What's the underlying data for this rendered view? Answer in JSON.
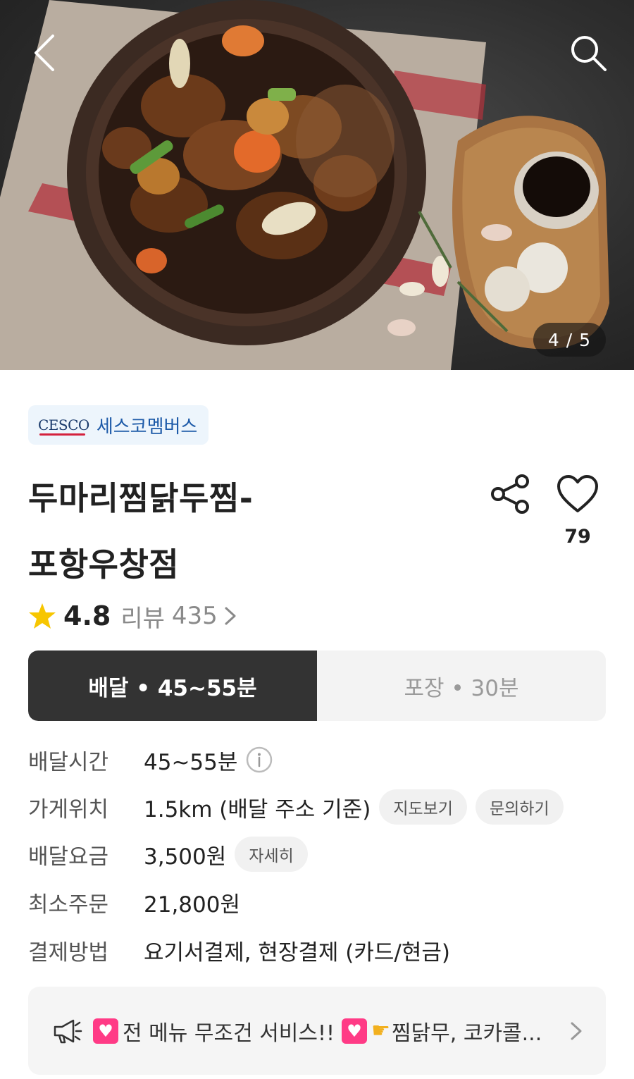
{
  "hero": {
    "image_counter": "4 / 5",
    "back_icon": "chevron-left-icon",
    "search_icon": "search-icon"
  },
  "brand": {
    "logo_text": "CESCO",
    "name": "세스코멤버스"
  },
  "store": {
    "title_line1": "두마리찜닭두찜-",
    "title_line2": "포항우창점",
    "like_count": "79",
    "rating": "4.8",
    "review_label": "리뷰",
    "review_count": "435"
  },
  "tabs": [
    {
      "label": "배달 • 45~55분",
      "active": true
    },
    {
      "label": "포장 • 30분",
      "active": false
    }
  ],
  "info": {
    "delivery_time": {
      "label": "배달시간",
      "value": "45~55분"
    },
    "location": {
      "label": "가게위치",
      "value": "1.5km (배달 주소 기준)",
      "map_button": "지도보기",
      "inquiry_button": "문의하기"
    },
    "delivery_fee": {
      "label": "배달요금",
      "value": "3,500원",
      "detail_button": "자세히"
    },
    "min_order": {
      "label": "최소주문",
      "value": "21,800원"
    },
    "payment": {
      "label": "결제방법",
      "value": "요기서결제, 현장결제 (카드/현금)"
    }
  },
  "notice": {
    "part1": "전 메뉴 무조건 서비스!!",
    "part2": "찜닭무, 코카콜...",
    "icon": "megaphone-icon"
  },
  "colors": {
    "tab_active_bg": "#333333",
    "brand_chip_bg": "#edf5fc",
    "brand_text": "#1d5aa8",
    "star": "#f7c600",
    "heart_emoji": "#ff3b86"
  }
}
